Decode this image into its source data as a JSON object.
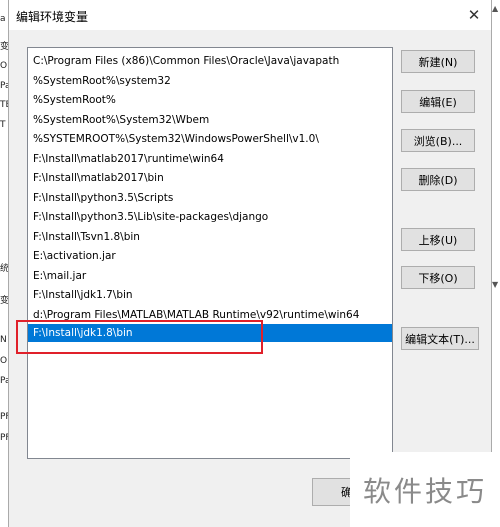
{
  "dialog": {
    "title": "编辑环境变量",
    "close_glyph": "✕"
  },
  "paths": [
    "C:\\Program Files (x86)\\Common Files\\Oracle\\Java\\javapath",
    "%SystemRoot%\\system32",
    "%SystemRoot%",
    "%SystemRoot%\\System32\\Wbem",
    "%SYSTEMROOT%\\System32\\WindowsPowerShell\\v1.0\\",
    "F:\\Install\\matlab2017\\runtime\\win64",
    "F:\\Install\\matlab2017\\bin",
    "F:\\Install\\python3.5\\Scripts",
    "F:\\Install\\python3.5\\Lib\\site-packages\\django",
    "F:\\Install\\Tsvn1.8\\bin",
    "E:\\activation.jar",
    "E:\\mail.jar",
    "F:\\Install\\jdk1.7\\bin",
    "d:\\Program Files\\MATLAB\\MATLAB Runtime\\v92\\runtime\\win64",
    "F:\\Install\\jdk1.8\\bin"
  ],
  "selected_index": 14,
  "buttons": {
    "new": "新建(N)",
    "edit": "编辑(E)",
    "browse": "浏览(B)...",
    "delete": "删除(D)",
    "move_up": "上移(U)",
    "move_down": "下移(O)",
    "edit_text": "编辑文本(T)...",
    "ok_partial": "确"
  },
  "background_fragments": [
    "a",
    "变",
    "O",
    "Pa",
    "TE",
    "T",
    "统",
    "变",
    "N",
    "O",
    "Pa",
    "PF",
    "PF"
  ],
  "watermark": "软件技巧",
  "colors": {
    "selection": "#0078d7",
    "annotation_red": "#e0202a"
  }
}
